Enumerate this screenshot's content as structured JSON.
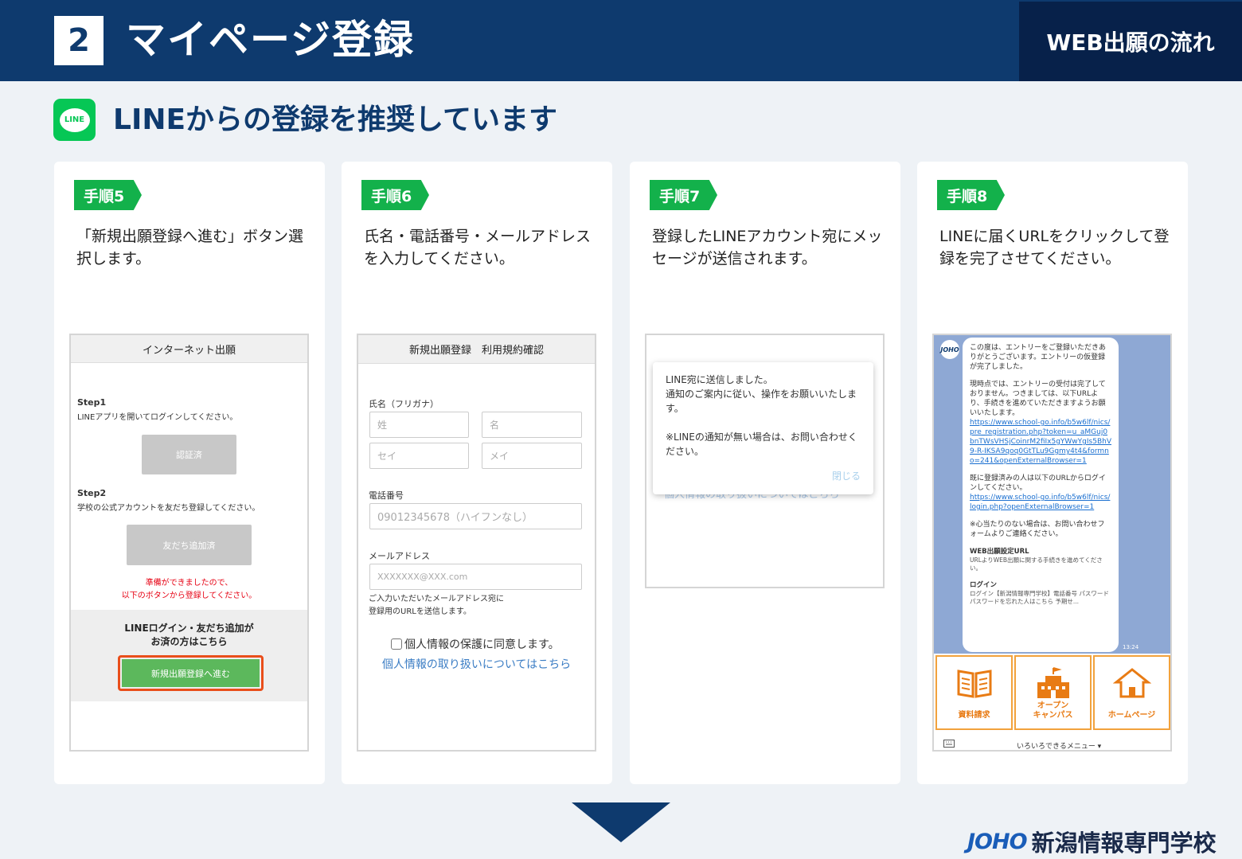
{
  "header": {
    "step_number": "2",
    "title": "マイページ登録",
    "flow_label": "WEB出願の流れ"
  },
  "recommend": {
    "logo_text": "LINE",
    "title": "LINEからの登録を推奨しています"
  },
  "steps": [
    {
      "tag": "手順5",
      "description": "「新規出願登録へ進む」ボタン選択します。",
      "screen": {
        "header": "インターネット出願",
        "step1_label": "Step1",
        "step1_text": "LINEアプリを開いてログインしてください。",
        "step1_button": "認証済",
        "step2_label": "Step2",
        "step2_text": "学校の公式アカウントを友だち登録してください。",
        "step2_button": "友だち追加済",
        "ready_line1": "準備ができましたので、",
        "ready_line2": "以下のボタンから登録してください。",
        "done_line1": "LINEログイン・友だち追加が",
        "done_line2": "お済の方はこちら",
        "register_button": "新規出願登録へ進む"
      }
    },
    {
      "tag": "手順6",
      "description": "氏名・電話番号・メールアドレスを入力してください。",
      "screen": {
        "header": "新規出願登録　利用規約確認",
        "name_label": "氏名（フリガナ）",
        "sei_kanji_placeholder": "姓",
        "mei_kanji_placeholder": "名",
        "sei_kana_placeholder": "セイ",
        "mei_kana_placeholder": "メイ",
        "phone_label": "電話番号",
        "phone_placeholder": "09012345678（ハイフンなし）",
        "email_label": "メールアドレス",
        "email_placeholder": "XXXXXXX@XXX.com",
        "email_note_line1": "ご入力いただいたメールアドレス宛に",
        "email_note_line2": "登録用のURLを送信します。",
        "consent_text": "個人情報の保護に同意します。",
        "privacy_link": "個人情報の取り扱いについてはこちら"
      }
    },
    {
      "tag": "手順7",
      "description": "登録したLINEアカウント宛にメッセージが送信されます。",
      "screen": {
        "dialog_line1": "LINE宛に送信しました。",
        "dialog_line2": "通知のご案内に従い、操作をお願いいたします。",
        "dialog_line3": "※LINEの通知が無い場合は、お問い合わせください。",
        "close_label": "閉じる",
        "underlay_link": "個人情報の取り扱いについてはこちら"
      }
    },
    {
      "tag": "手順8",
      "description": "LINEに届くURLをクリックして登録を完了させてください。",
      "screen": {
        "avatar": "JOHO",
        "msg_intro": "この度は、エントリーをご登録いただきありがとうございます。エントリーの仮登録が完了しました。",
        "msg_status": "現時点では、エントリーの受付は完了しておりません。つきましては、以下URLより、手続きを進めていただきますようお願いいたします。",
        "msg_url1": "https://www.school-go.info/b5w6lf/nics/pre_registration.php?token=u_aMGuj0bnTWsVHSjCoinrM2fiIx5gYWwYgIs5BhV9-R-IKSA9qoq0GtTLu9Ggmy4t4&formno=241&openExternalBrowser=1",
        "msg_login": "既に登録済みの人は以下のURLからログインしてください。",
        "msg_url2": "https://www.school-go.info/b5w6lf/nics/login.php?openExternalBrowser=1",
        "msg_contact": "※心当たりのない場合は、お問い合わせフォームよりご連絡ください。",
        "card1_title": "WEB出願設定URL",
        "card1_text": "URLよりWEB出願に関する手続きを進めてください。",
        "card2_title": "ログイン",
        "card2_text": "ログイン【新潟情報専門学校】電話番号 パスワード パスワードを忘れた人はこちら 予期せ...",
        "time": "13:24",
        "menu1": "資料請求",
        "menu2_line1": "オープン",
        "menu2_line2": "キャンパス",
        "menu3": "ホームページ",
        "menu_bar": "いろいろできるメニュー ▾"
      }
    }
  ],
  "footer": {
    "logo_mark": "JOHO",
    "school_name": "新潟情報専門学校"
  },
  "colors": {
    "navy": "#0e3a6e",
    "line_green": "#06c755",
    "tag_green": "#13b14b",
    "accent_red": "#e94e1b",
    "menu_orange": "#f2a23c"
  }
}
